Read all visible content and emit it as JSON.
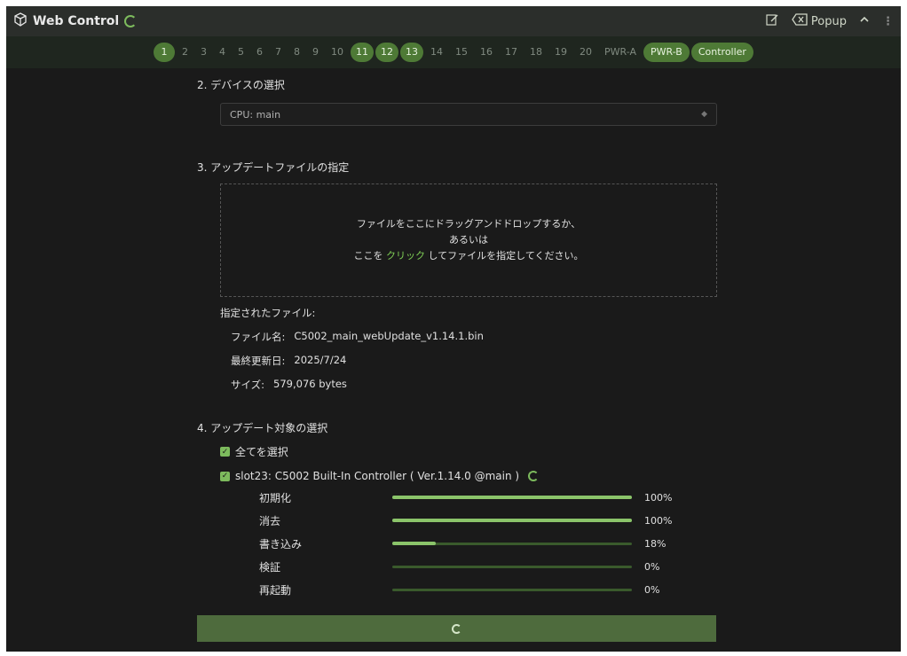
{
  "app": {
    "title": "Web Control",
    "popup_label": "Popup"
  },
  "tabs": [
    {
      "label": "1",
      "state": "active"
    },
    {
      "label": "2",
      "state": "normal"
    },
    {
      "label": "3",
      "state": "normal"
    },
    {
      "label": "4",
      "state": "normal"
    },
    {
      "label": "5",
      "state": "normal"
    },
    {
      "label": "6",
      "state": "normal"
    },
    {
      "label": "7",
      "state": "normal"
    },
    {
      "label": "8",
      "state": "normal"
    },
    {
      "label": "9",
      "state": "normal"
    },
    {
      "label": "10",
      "state": "normal"
    },
    {
      "label": "11",
      "state": "active"
    },
    {
      "label": "12",
      "state": "active"
    },
    {
      "label": "13",
      "state": "active"
    },
    {
      "label": "14",
      "state": "normal"
    },
    {
      "label": "15",
      "state": "normal"
    },
    {
      "label": "16",
      "state": "normal"
    },
    {
      "label": "17",
      "state": "normal"
    },
    {
      "label": "18",
      "state": "normal"
    },
    {
      "label": "19",
      "state": "normal"
    },
    {
      "label": "20",
      "state": "normal"
    },
    {
      "label": "PWR-A",
      "state": "normal"
    },
    {
      "label": "PWR-B",
      "state": "pill"
    },
    {
      "label": "Controller",
      "state": "pill"
    }
  ],
  "device": {
    "section_title": "2. デバイスの選択",
    "selected": "CPU: main"
  },
  "file_spec": {
    "section_title": "3. アップデートファイルの指定",
    "drop_line1": "ファイルをここにドラッグアンドドロップするか、",
    "drop_line2": "あるいは",
    "drop_line3_prefix": "ここを ",
    "drop_link": "クリック",
    "drop_line3_suffix": " してファイルを指定してください。",
    "specified_label": "指定されたファイル:",
    "name_label": "ファイル名:",
    "name_value": "C5002_main_webUpdate_v1.14.1.bin",
    "date_label": "最終更新日:",
    "date_value": "2025/7/24",
    "size_label": "サイズ:",
    "size_value": "579,076 bytes"
  },
  "targets": {
    "section_title": "4. アップデート対象の選択",
    "select_all": "全てを選択",
    "slot_label": "slot23: C5002 Built-In Controller ( Ver.1.14.0 @main )",
    "steps": [
      {
        "label": "初期化",
        "percent": 100,
        "text": "100%"
      },
      {
        "label": "消去",
        "percent": 100,
        "text": "100%"
      },
      {
        "label": "書き込み",
        "percent": 18,
        "text": "18%"
      },
      {
        "label": "検証",
        "percent": 0,
        "text": "0%"
      },
      {
        "label": "再起動",
        "percent": 0,
        "text": "0%"
      }
    ]
  },
  "colors": {
    "accent": "#7dbb5d",
    "bar_fill": "#8bc46a",
    "bar_track": "#3a5a2c"
  }
}
